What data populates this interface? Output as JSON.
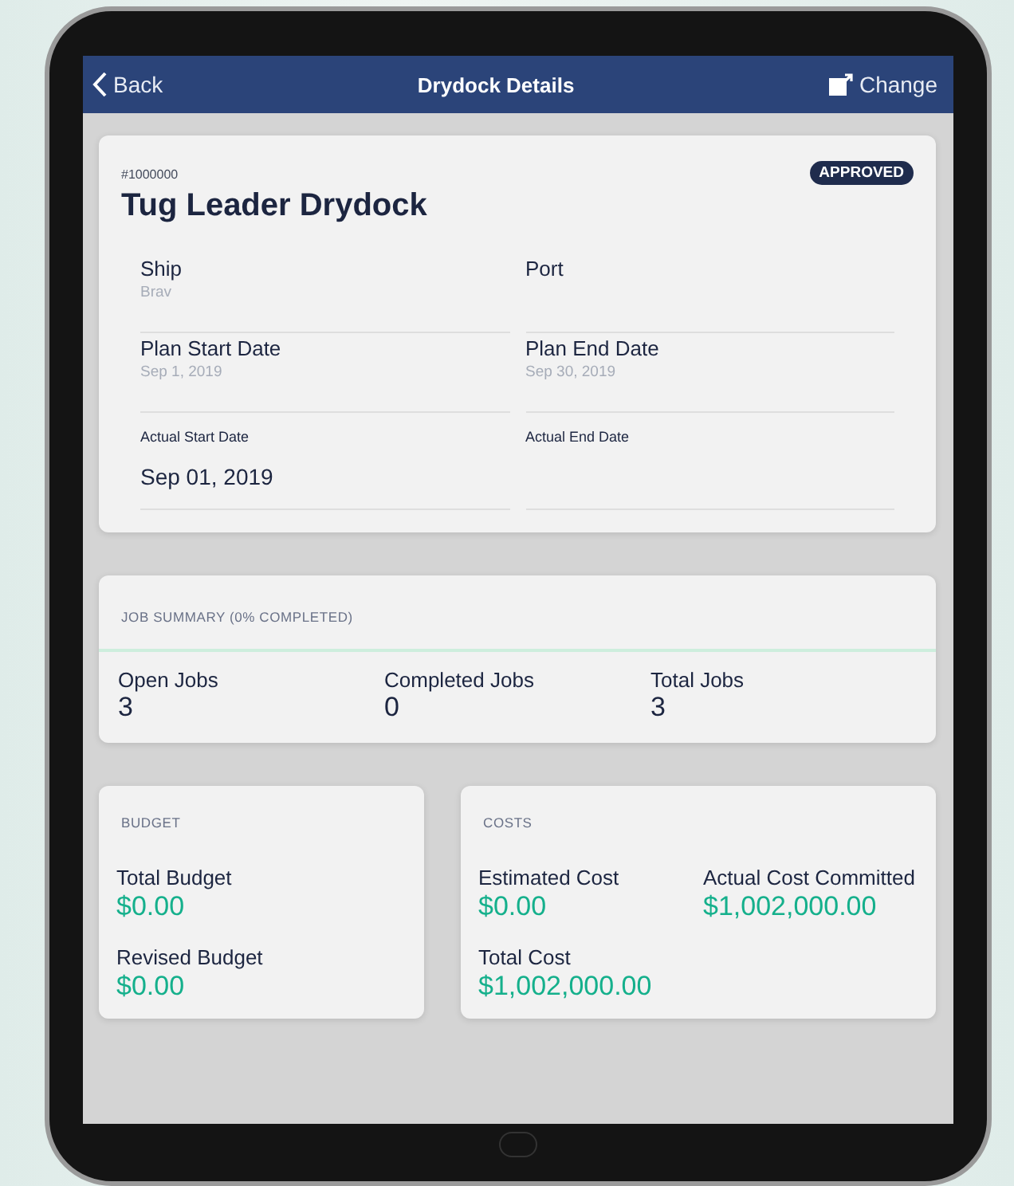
{
  "header": {
    "back": "Back",
    "title": "Drydock Details",
    "action": "Change"
  },
  "drydock": {
    "number": "#1000000",
    "status": "APPROVED",
    "name": "Tug Leader Drydock",
    "fields": [
      {
        "kind": "plan",
        "label": "Ship",
        "value": "Brav"
      },
      {
        "kind": "plan",
        "label": "Port"
      },
      {
        "kind": "plan",
        "label": "Plan Start Date",
        "value": "Sep 1, 2019"
      },
      {
        "kind": "plan",
        "label": "Plan End Date",
        "value": "Sep 30, 2019"
      },
      {
        "kind": "actual",
        "label": "Actual Start Date",
        "value": "Sep 01, 2019"
      },
      {
        "kind": "actual",
        "label": "Actual End Date"
      }
    ]
  },
  "job_summary": {
    "title": "JOB SUMMARY (0% COMPLETED)",
    "stats": [
      {
        "label": "Open Jobs",
        "value": "3"
      },
      {
        "label": "Completed Jobs",
        "value": "0"
      },
      {
        "label": "Total Jobs",
        "value": "3"
      }
    ]
  },
  "budget": {
    "title": "BUDGET",
    "items": [
      {
        "label": "Total Budget",
        "value": "$0.00"
      },
      {
        "label": "Revised Budget",
        "value": "$0.00"
      }
    ]
  },
  "costs": {
    "title": "COSTS",
    "items": [
      {
        "label": "Estimated Cost",
        "value": "$0.00"
      },
      {
        "label": "Actual Cost Committed",
        "value": "$1,002,000.00"
      },
      {
        "label": "Total Cost",
        "value": "$1,002,000.00"
      }
    ]
  }
}
